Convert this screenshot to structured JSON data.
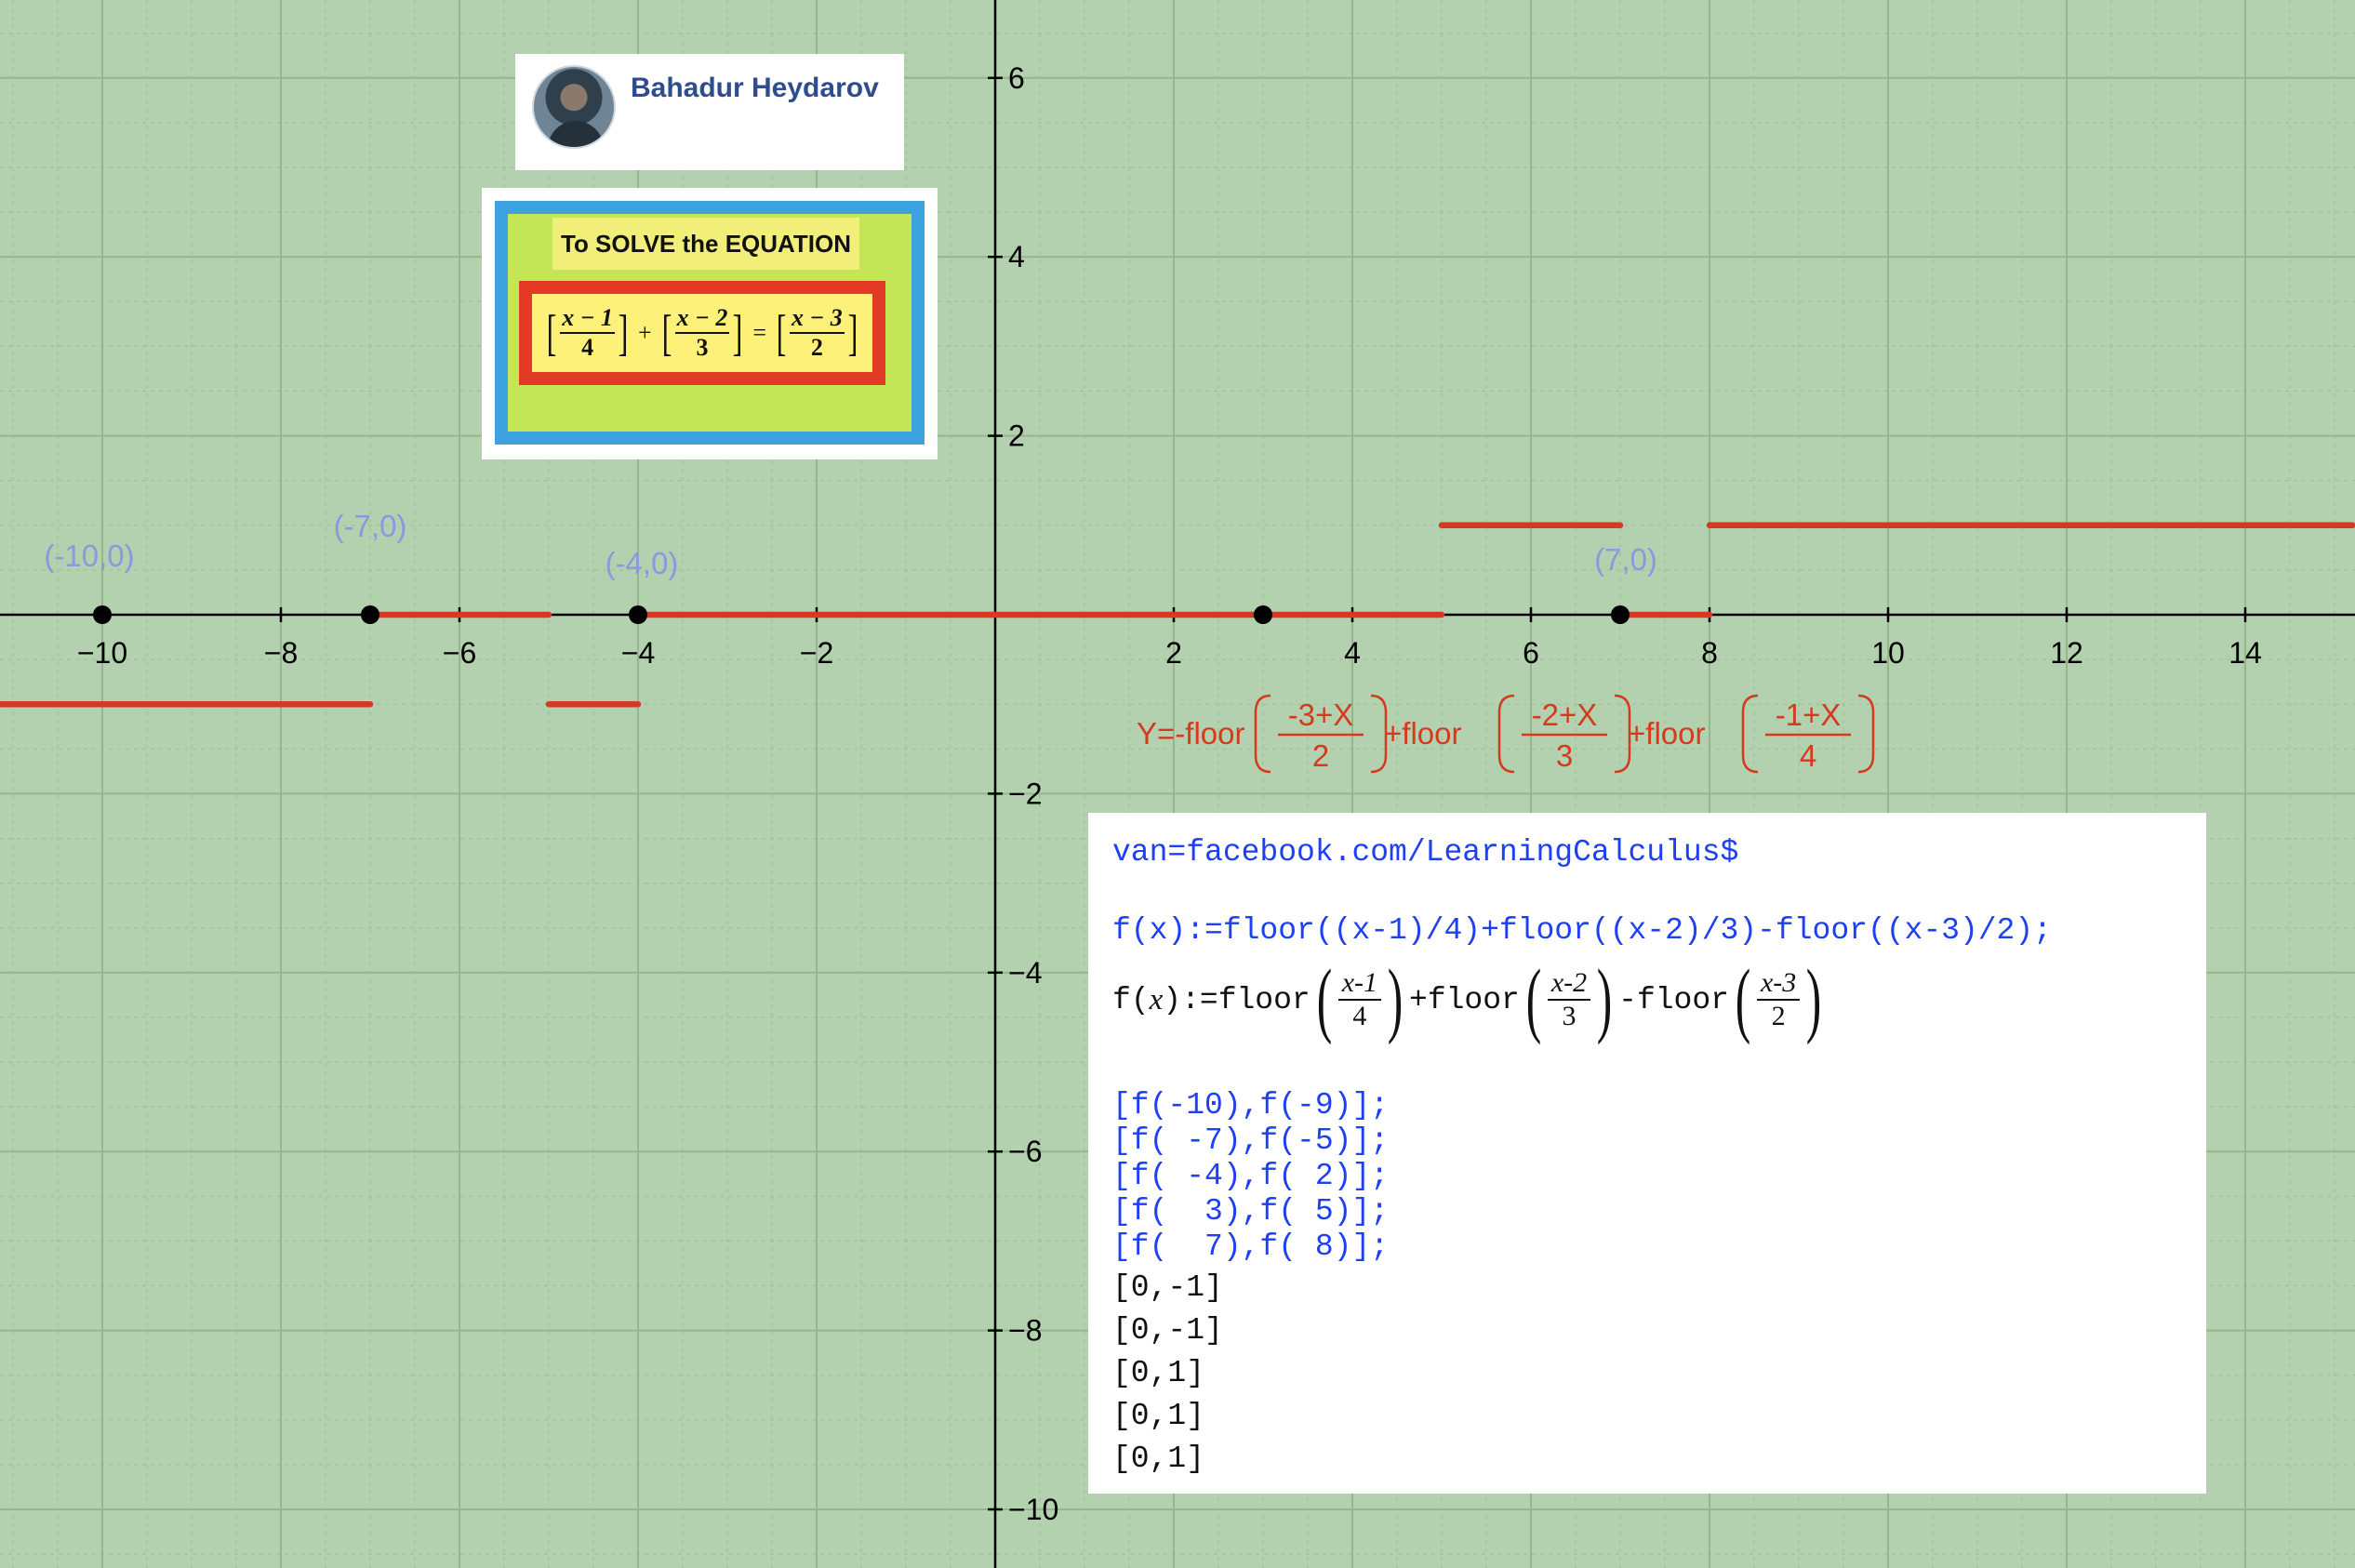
{
  "colors": {
    "background": "#b3d1ae",
    "plot": "#d63a1e",
    "point_label": "#8e97df",
    "axis": "#000000",
    "maxima_input": "#1d3ff5"
  },
  "author": {
    "name": "Bahadur Heydarov",
    "icon": "avatar-photo"
  },
  "equation_card": {
    "title": "To SOLVE the EQUATION",
    "terms": [
      {
        "numerator": "x − 1",
        "denominator": "4"
      },
      {
        "numerator": "x − 2",
        "denominator": "3"
      },
      {
        "numerator": "x − 3",
        "denominator": "2"
      }
    ],
    "plus": "+",
    "equals": "="
  },
  "chart_data": {
    "type": "line",
    "xlim": [
      -11.2,
      15.2
    ],
    "ylim": [
      -10.6,
      6.9
    ],
    "x_ticks": [
      -10,
      -8,
      -6,
      -4,
      -2,
      2,
      4,
      6,
      8,
      10,
      12,
      14
    ],
    "y_ticks": [
      6,
      4,
      2,
      -2,
      -4,
      -6,
      -8,
      -10
    ],
    "grid": true,
    "series": [
      {
        "color": "#d63a1e",
        "segments": [
          {
            "x": [
              -11.2,
              -7
            ],
            "y": [
              -1,
              -1
            ]
          },
          {
            "x": [
              -7,
              -5
            ],
            "y": [
              0,
              0
            ]
          },
          {
            "x": [
              -5,
              -4
            ],
            "y": [
              -1,
              -1
            ]
          },
          {
            "x": [
              -4,
              5
            ],
            "y": [
              0,
              0
            ]
          },
          {
            "x": [
              5,
              7
            ],
            "y": [
              1,
              1
            ]
          },
          {
            "x": [
              7,
              8
            ],
            "y": [
              0,
              0
            ]
          },
          {
            "x": [
              8,
              15.2
            ],
            "y": [
              1,
              1
            ]
          }
        ]
      }
    ],
    "points": [
      {
        "x": -10,
        "y": 0,
        "label": "(-10,0)"
      },
      {
        "x": -7,
        "y": 0,
        "label": "(-7,0)"
      },
      {
        "x": -4,
        "y": 0,
        "label": "(-4,0)"
      },
      {
        "x": 3,
        "y": 0,
        "label": ""
      },
      {
        "x": 7,
        "y": 0,
        "label": "(7,0)"
      }
    ],
    "function_label": {
      "prefix": "Y=-floor",
      "joiner": "+floor",
      "fractions": [
        {
          "numerator": "-3+X",
          "denominator": "2"
        },
        {
          "numerator": "-2+X",
          "denominator": "3"
        },
        {
          "numerator": "-1+X",
          "denominator": "4"
        }
      ]
    }
  },
  "maxima": {
    "line1": "van=facebook.com/LearningCalculus$",
    "definition": "f(x):=floor((x-1)/4)+floor((x-2)/3)-floor((x-3)/2);",
    "display": {
      "lhs_f": "f",
      "lhs_x": "x",
      "assign": ":=",
      "floor": "floor",
      "plus": "+",
      "minus": "-",
      "fractions": [
        {
          "numerator": "x-1",
          "denominator": "4"
        },
        {
          "numerator": "x-2",
          "denominator": "3"
        },
        {
          "numerator": "x-3",
          "denominator": "2"
        }
      ]
    },
    "inputs": [
      "[f(-10),f(-9)];",
      "[f( -7),f(-5)];",
      "[f( -4),f( 2)];",
      "[f(  3),f( 5)];",
      "[f(  7),f( 8)];"
    ],
    "outputs": [
      "[0,-1]",
      "[0,-1]",
      "[0,1]",
      "[0,1]",
      "[0,1]"
    ]
  }
}
